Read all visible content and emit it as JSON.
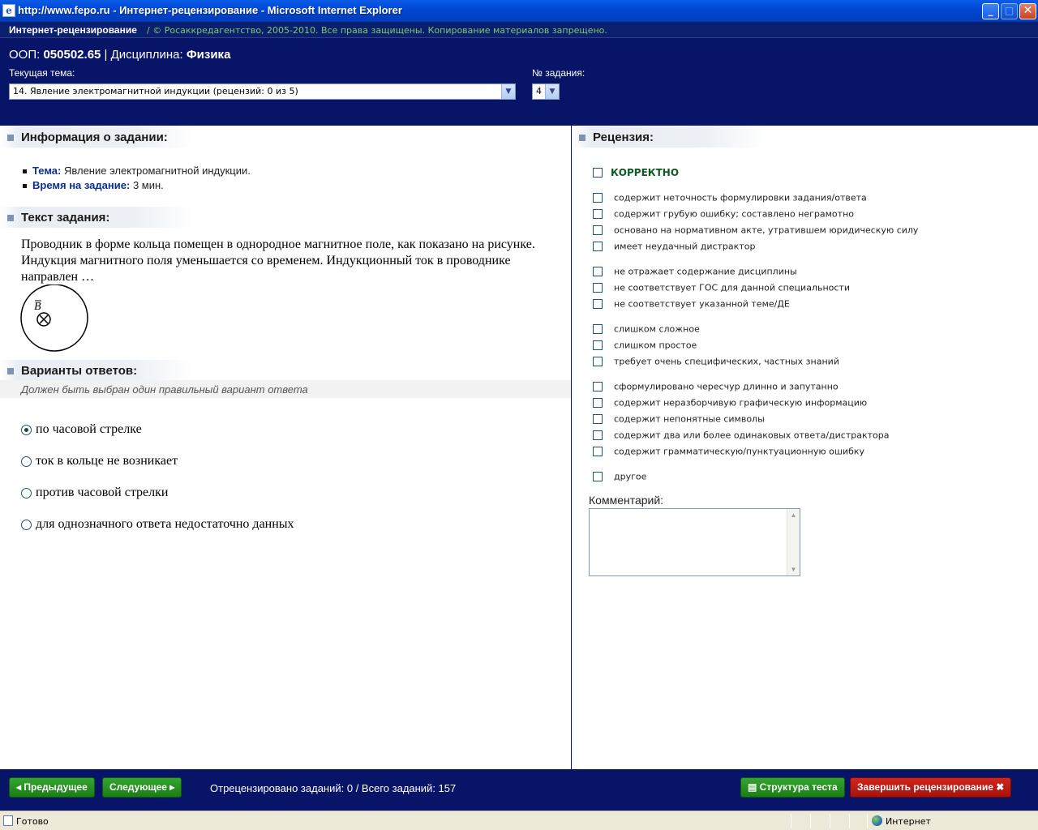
{
  "window": {
    "title": "http://www.fepo.ru - Интернет-рецензирование - Microsoft Internet Explorer",
    "min": "_",
    "max": "□",
    "close": "✕"
  },
  "header": {
    "brand": "Интернет-рецензирование",
    "copyright": "/  © Росаккредагентство, 2005-2010. Все права защищены. Копирование материалов запрещено.",
    "oop_label": "ООП:",
    "oop_value": "050502.65",
    "separator": "|",
    "discipline_label": "Дисциплина:",
    "discipline_value": "Физика",
    "topic_label": "Текущая тема:",
    "topic_value": "14. Явление электромагнитной индукции  (рецензий: 0 из 5)",
    "task_num_label": "№ задания:",
    "task_num_value": "4"
  },
  "task_info": {
    "heading": "Информация о задании:",
    "topic_key": "Тема:",
    "topic_val": "Явление электромагнитной индукции.",
    "time_key": "Время на задание:",
    "time_val": "3 мин."
  },
  "task_text": {
    "heading": "Текст задания:",
    "body": "Проводник в форме кольца помещен в однородное магнитное поле, как показано на рисунке. Индукция магнитного поля уменьшается со временем. Индукционный ток в проводнике направлен …",
    "figure_label": "B"
  },
  "variants": {
    "heading": "Варианты ответов:",
    "note": "Должен быть выбран один правильный вариант ответа",
    "options": [
      {
        "text": "по часовой стрелке",
        "selected": true
      },
      {
        "text": "ток в кольце не возникает",
        "selected": false
      },
      {
        "text": "против часовой стрелки",
        "selected": false
      },
      {
        "text": "для однозначного ответа недостаточно данных",
        "selected": false
      }
    ]
  },
  "review": {
    "heading": "Рецензия:",
    "correct": "КОРРЕКТНО",
    "items": [
      "содержит неточность формулировки задания/ответа",
      "содержит грубую ошибку; составлено неграмотно",
      "основано на нормативном акте, утратившем юридическую силу",
      "имеет неудачный дистрактор",
      "не отражает содержание дисциплины",
      "не соответствует ГОС для данной специальности",
      "не соответствует указанной теме/ДЕ",
      "слишком сложное",
      "слишком простое",
      "требует очень специфических, частных знаний",
      "сформулировано чересчур длинно и запутанно",
      "содержит неразборчивую графическую информацию",
      "содержит непонятные символы",
      "содержит два или более одинаковых ответа/дистрактора",
      "содержит грамматическую/пунктуационную ошибку",
      "другое"
    ],
    "comment_label": "Комментарий:"
  },
  "footer": {
    "prev": "◂ Предыдущее",
    "next": "Следующее ▸",
    "counter": "Отрецензировано заданий: 0 / Всего заданий:  157",
    "structure": "▤ Структура теста",
    "finish": "Завершить рецензирование ✖"
  },
  "statusbar": {
    "ready": "Готово",
    "zone": "Интернет"
  }
}
